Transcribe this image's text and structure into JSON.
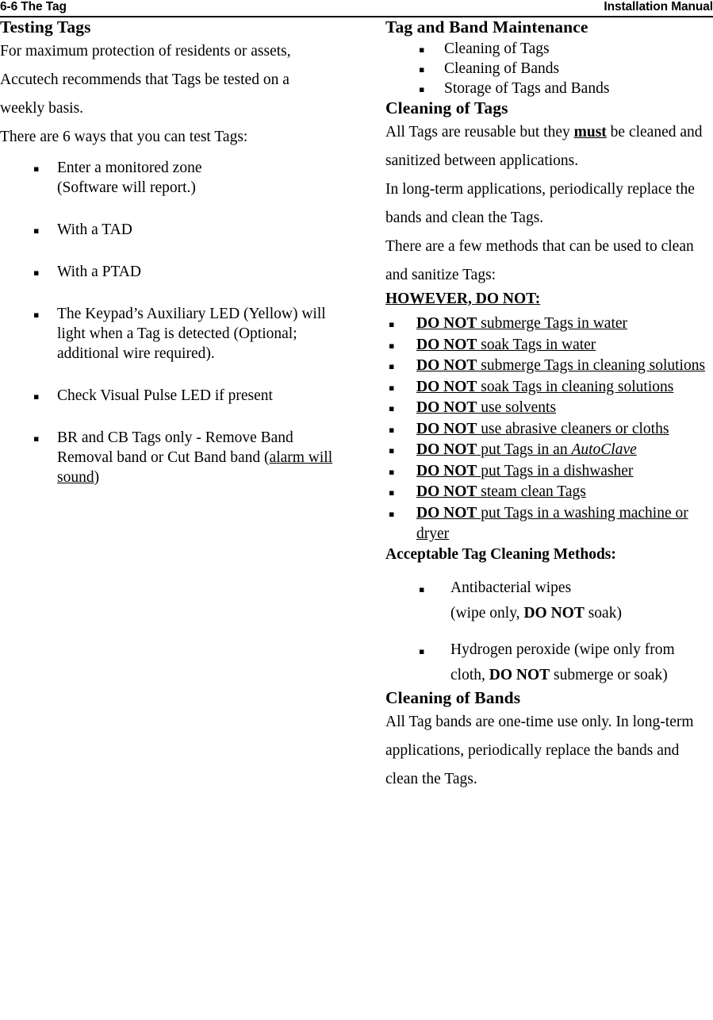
{
  "header": {
    "left": "6-6 The Tag",
    "right": "Installation Manual"
  },
  "bullet_glyph": "▪",
  "left_column": {
    "title": "Testing Tags",
    "paragraph_1": "For maximum protection of residents or assets, Accutech recommends that Tags be tested on a weekly basis.",
    "paragraph_2": "There are 6 ways that you can test Tags:",
    "ways": [
      {
        "line_1": "Enter a monitored zone",
        "line_2": "(Software will report.)"
      },
      {
        "line_1": "With a TAD"
      },
      {
        "line_1": "With a PTAD"
      },
      {
        "line_1": "The Keypad’s Auxiliary LED (Yellow) will light when a Tag is detected (Optional; additional wire required)."
      },
      {
        "line_1": "Check Visual Pulse LED if present"
      },
      {
        "line_1": "BR and CB Tags only - Remove Band Removal band or Cut Band band  (",
        "underlined": "alarm will sound",
        "tail": ")"
      }
    ]
  },
  "right_column": {
    "title": "Tag and Band Maintenance",
    "maintenance_items": [
      "Cleaning of Tags",
      "Cleaning of Bands",
      "Storage of Tags and Bands"
    ],
    "cleaning_tags": {
      "heading": "Cleaning of Tags",
      "paragraph_1_pre": "All Tags are reusable but they ",
      "paragraph_1_emph": "must",
      "paragraph_1_post": " be cleaned and sanitized between applications.",
      "paragraph_2": "In long-term applications, periodically replace the bands and clean the Tags.",
      "paragraph_3": "There are a few methods that can be used to clean and sanitize Tags:",
      "however_heading": "HOWEVER, DO NOT:",
      "do_not_prefix": "DO NOT",
      "do_not_items": [
        " submerge Tags in water",
        " soak Tags in water",
        " submerge Tags in cleaning solutions",
        " soak Tags in cleaning solutions",
        " use solvents",
        " use abrasive cleaners or cloths",
        " put Tags in an AutoClave",
        " put Tags in a dishwasher",
        " steam clean Tags",
        " put Tags in a washing machine or dryer"
      ],
      "acceptable_heading": "Acceptable Tag Cleaning Methods:",
      "acceptable_items": [
        {
          "line_1": "Antibacterial wipes",
          "line_2_pre": "(wipe only, ",
          "line_2_emph": "DO NOT",
          "line_2_post": " soak)"
        },
        {
          "line_1_pre": "Hydrogen peroxide (wipe only from cloth, ",
          "line_1_emph": "DO NOT",
          "line_1_post": " submerge or soak)"
        }
      ]
    },
    "cleaning_bands": {
      "heading": "Cleaning of Bands",
      "paragraph_1": "All Tag bands are one-time use only. In long-term applications, periodically replace the bands and clean the Tags."
    }
  }
}
